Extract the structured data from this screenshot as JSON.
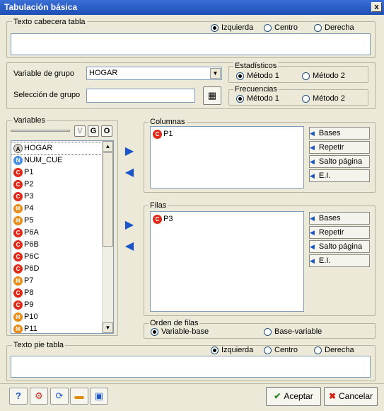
{
  "window": {
    "title": "Tabulación básica",
    "close_label": "x"
  },
  "header_text": {
    "label": "Texto cabecera tabla",
    "value": "",
    "align_options": [
      "Izquierda",
      "Centro",
      "Derecha"
    ],
    "selected": "Izquierda"
  },
  "group": {
    "variable_label": "Variable de grupo",
    "variable_value": "HOGAR",
    "selection_label": "Selección de grupo",
    "selection_value": "",
    "estadisticos": {
      "label": "Estadísticos",
      "options": [
        "Método 1",
        "Método 2"
      ],
      "selected": "Método 1"
    },
    "frecuencias": {
      "label": "Frecuencias",
      "options": [
        "Método 1",
        "Método 2"
      ],
      "selected": "Método 1"
    }
  },
  "variables": {
    "label": "Variables",
    "filter_buttons": [
      "V",
      "G",
      "O"
    ],
    "items": [
      {
        "type": "A",
        "name": "HOGAR"
      },
      {
        "type": "N",
        "name": "NUM_CUE"
      },
      {
        "type": "C",
        "name": "P1"
      },
      {
        "type": "C",
        "name": "P2"
      },
      {
        "type": "C",
        "name": "P3"
      },
      {
        "type": "M",
        "name": "P4"
      },
      {
        "type": "M",
        "name": "P5"
      },
      {
        "type": "C",
        "name": "P6A"
      },
      {
        "type": "C",
        "name": "P6B"
      },
      {
        "type": "C",
        "name": "P6C"
      },
      {
        "type": "C",
        "name": "P6D"
      },
      {
        "type": "M",
        "name": "P7"
      },
      {
        "type": "C",
        "name": "P8"
      },
      {
        "type": "C",
        "name": "P9"
      },
      {
        "type": "M",
        "name": "P10"
      },
      {
        "type": "M",
        "name": "P11"
      }
    ]
  },
  "columnas": {
    "label": "Columnas",
    "items": [
      {
        "type": "C",
        "name": "P1"
      }
    ]
  },
  "filas": {
    "label": "Filas",
    "items": [
      {
        "type": "C",
        "name": "P3"
      }
    ]
  },
  "side_buttons": {
    "bases": "Bases",
    "repetir": "Repetir",
    "salto": "Salto página",
    "ei": "E.I."
  },
  "orden_filas": {
    "label": "Orden de filas",
    "options": [
      "Variable-base",
      "Base-variable"
    ],
    "selected": "Variable-base"
  },
  "footer_text": {
    "label": "Texto pie tabla",
    "value": "",
    "align_options": [
      "Izquierda",
      "Centro",
      "Derecha"
    ],
    "selected": "Izquierda"
  },
  "actions": {
    "accept": "Aceptar",
    "cancel": "Cancelar"
  },
  "icons": {
    "help": "help-icon",
    "tool2": "settings-icon",
    "tool3": "refresh-icon",
    "tool4": "folder-icon",
    "tool5": "save-icon"
  }
}
